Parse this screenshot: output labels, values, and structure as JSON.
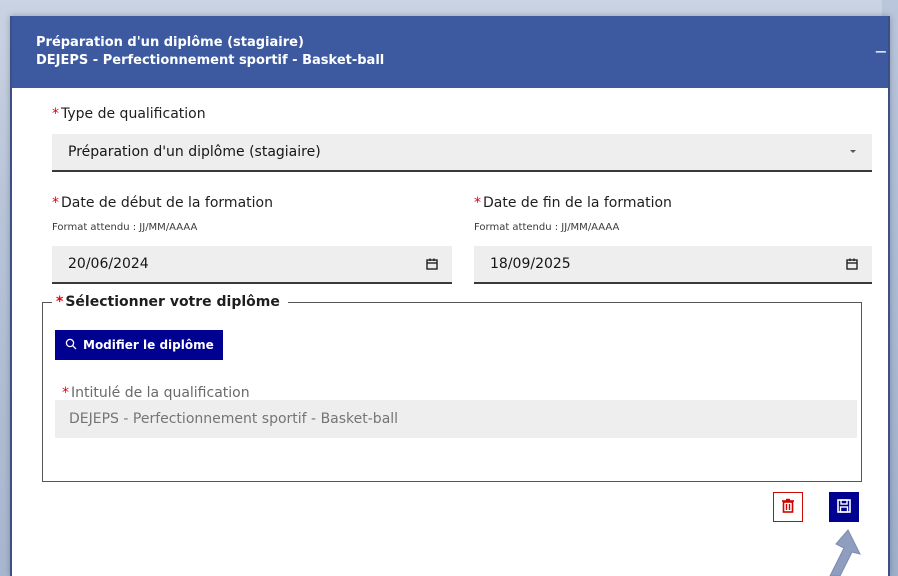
{
  "header": {
    "title": "Préparation d'un diplôme (stagiaire)",
    "subtitle": "DEJEPS - Perfectionnement sportif - Basket-ball",
    "collapse_glyph": "−"
  },
  "required_marker": "*",
  "qualification_type": {
    "label": "Type de qualification",
    "value": "Préparation d'un diplôme (stagiaire)",
    "icon": "caret-down-icon"
  },
  "start_date": {
    "label": "Date de début de la formation",
    "hint": "Format attendu : JJ/MM/AAAA",
    "value": "20/06/2024",
    "icon": "calendar-icon"
  },
  "end_date": {
    "label": "Date de fin de la formation",
    "hint": "Format attendu : JJ/MM/AAAA",
    "value": "18/09/2025",
    "icon": "calendar-icon"
  },
  "diploma_section": {
    "legend": "Sélectionner votre diplôme",
    "modify_button": "Modifier le diplôme",
    "title_label": "Intitulé de la qualification",
    "title_value": "DEJEPS - Perfectionnement sportif - Basket-ball"
  },
  "actions": {
    "delete_icon": "trash-icon",
    "save_icon": "save-icon"
  },
  "colors": {
    "header_bg": "#3d5aa1",
    "primary": "#000091",
    "danger": "#ce0500",
    "required": "#e1000f"
  }
}
